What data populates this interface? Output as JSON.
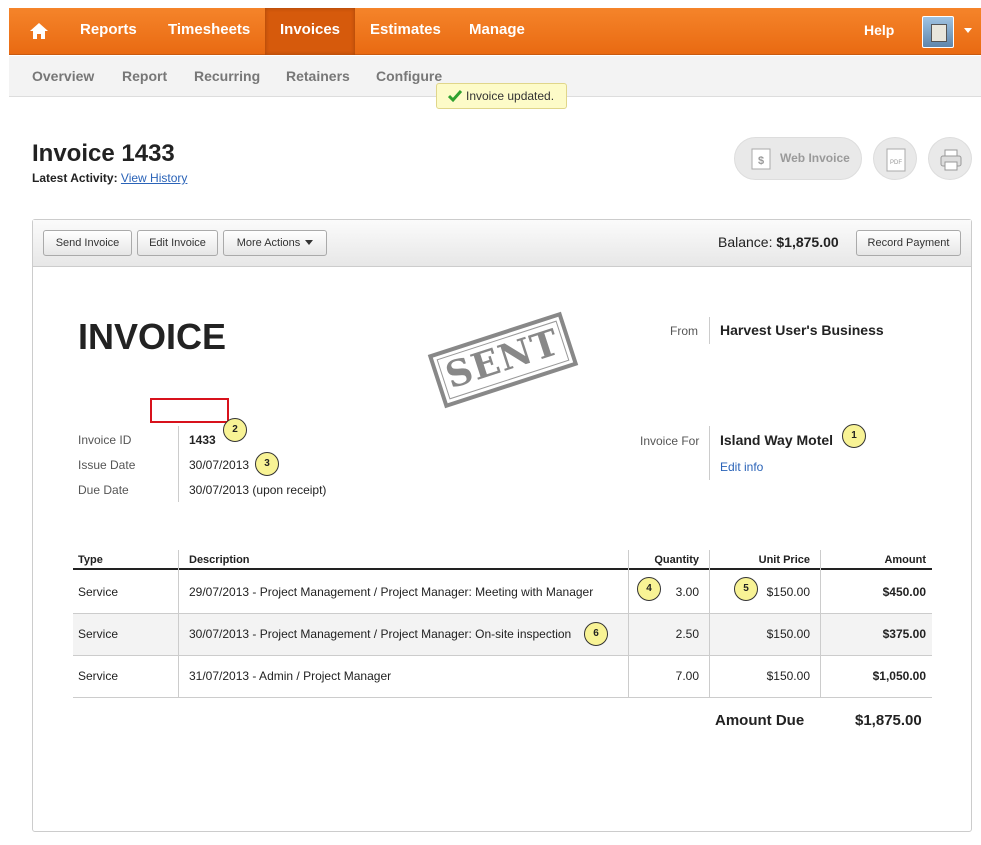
{
  "nav": {
    "items": [
      "Reports",
      "Timesheets",
      "Invoices",
      "Estimates",
      "Manage"
    ],
    "active": "Invoices",
    "help": "Help"
  },
  "subnav": [
    "Overview",
    "Report",
    "Recurring",
    "Retainers",
    "Configure"
  ],
  "toast": "Invoice updated.",
  "header": {
    "title": "Invoice 1433",
    "activity_label": "Latest Activity:",
    "view_history": "View History",
    "web_invoice": "Web Invoice",
    "pdf_label": "PDF"
  },
  "toolbar": {
    "send": "Send Invoice",
    "edit": "Edit Invoice",
    "more": "More Actions",
    "balance_label": "Balance:",
    "balance_value": "$1,875.00",
    "record": "Record Payment"
  },
  "invoice": {
    "heading": "INVOICE",
    "stamp": "SENT",
    "from_label": "From",
    "from_value": "Harvest User's Business",
    "id_label": "Invoice ID",
    "id_value": "1433",
    "issue_label": "Issue Date",
    "issue_value": "30/07/2013",
    "due_label": "Due Date",
    "due_value": "30/07/2013 (upon receipt)",
    "for_label": "Invoice For",
    "client": "Island Way Motel",
    "edit_info": "Edit info"
  },
  "table": {
    "headers": [
      "Type",
      "Description",
      "Quantity",
      "Unit Price",
      "Amount"
    ],
    "rows": [
      {
        "type": "Service",
        "desc": "29/07/2013 - Project Management / Project Manager: Meeting with Manager",
        "qty": "3.00",
        "price": "$150.00",
        "amount": "$450.00"
      },
      {
        "type": "Service",
        "desc": "30/07/2013 - Project Management / Project Manager: On-site inspection",
        "qty": "2.50",
        "price": "$150.00",
        "amount": "$375.00"
      },
      {
        "type": "Service",
        "desc": "31/07/2013 - Admin / Project Manager",
        "qty": "7.00",
        "price": "$150.00",
        "amount": "$1,050.00"
      }
    ],
    "amount_due_label": "Amount Due",
    "amount_due_value": "$1,875.00"
  },
  "callouts": [
    "1",
    "2",
    "3",
    "4",
    "5",
    "6"
  ],
  "colors": {
    "nav_orange": "#ef7620",
    "link_blue": "#2a63b8",
    "callout_yellow": "#f8f395",
    "highlight_red": "#d8121c"
  }
}
